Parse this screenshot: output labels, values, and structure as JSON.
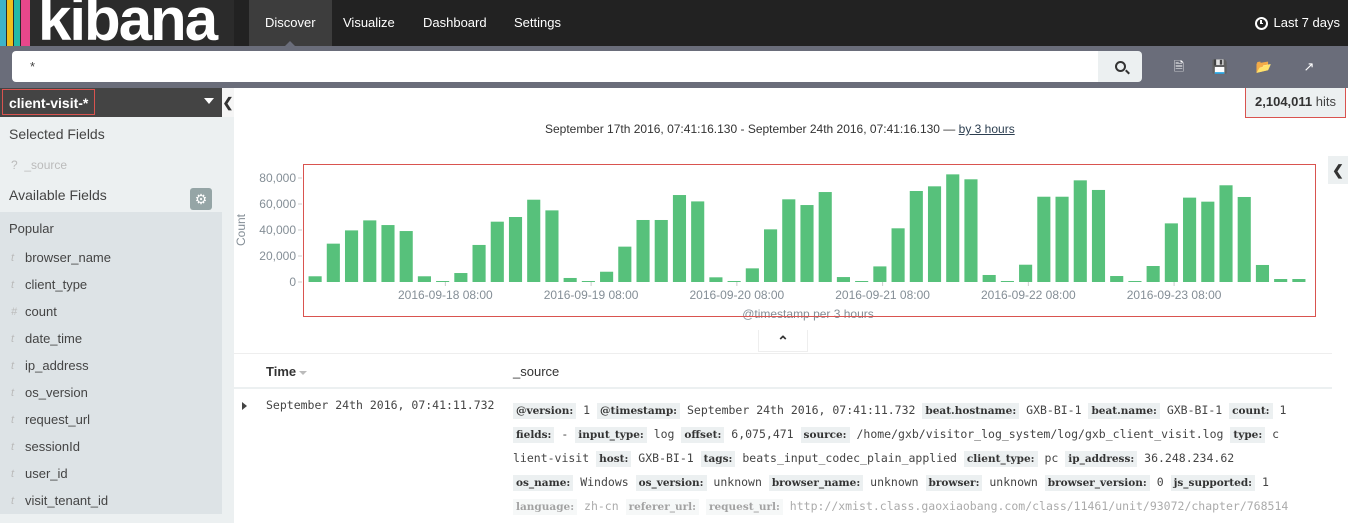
{
  "app": {
    "brand": "kibana",
    "brand_stripes": [
      "#3eb3c8",
      "#f0bf1a",
      "#24b9a6",
      "#e8478b"
    ]
  },
  "nav": {
    "tabs": [
      {
        "label": "Discover",
        "active": true
      },
      {
        "label": "Visualize",
        "active": false
      },
      {
        "label": "Dashboard",
        "active": false
      },
      {
        "label": "Settings",
        "active": false
      }
    ],
    "timepicker": "Last 7 days"
  },
  "search": {
    "query": "*",
    "toolbar_icons": [
      "new-search-icon",
      "save-search-icon",
      "open-search-icon",
      "share-icon"
    ]
  },
  "sidebar": {
    "index_pattern": "client-visit-*",
    "selected_fields_label": "Selected Fields",
    "selected_fields": [
      {
        "type": "?",
        "name": "_source"
      }
    ],
    "available_fields_label": "Available Fields",
    "popular_label": "Popular",
    "popular_fields": [
      {
        "type": "t",
        "name": "browser_name"
      },
      {
        "type": "t",
        "name": "client_type"
      },
      {
        "type": "#",
        "name": "count"
      },
      {
        "type": "t",
        "name": "date_time"
      },
      {
        "type": "t",
        "name": "ip_address"
      },
      {
        "type": "t",
        "name": "os_version"
      },
      {
        "type": "t",
        "name": "request_url"
      },
      {
        "type": "t",
        "name": "sessionId"
      },
      {
        "type": "t",
        "name": "user_id"
      },
      {
        "type": "t",
        "name": "visit_tenant_id"
      }
    ]
  },
  "hits": {
    "count": "2,104,011",
    "label": "hits"
  },
  "timerange": {
    "text": "September 17th 2016, 07:41:16.130 - September 24th 2016, 07:41:16.130 —",
    "interval_link": "by 3 hours"
  },
  "chart_data": {
    "type": "bar",
    "title": "",
    "xlabel": "@timestamp per 3 hours",
    "ylabel": "Count",
    "ylim": [
      0,
      85000
    ],
    "yticks": [
      0,
      20000,
      40000,
      60000,
      80000
    ],
    "ytick_labels": [
      "0",
      "20,000",
      "40,000",
      "60,000",
      "80,000"
    ],
    "xtick_labels": [
      "2016-09-18 08:00",
      "2016-09-19 08:00",
      "2016-09-20 08:00",
      "2016-09-21 08:00",
      "2016-09-22 08:00",
      "2016-09-23 08:00"
    ],
    "xtick_bar_index": [
      8,
      16,
      24,
      32,
      40,
      48
    ],
    "color": "#57c17b",
    "grid": false,
    "values": [
      4400,
      29500,
      39700,
      47400,
      43800,
      39200,
      4400,
      300,
      6900,
      28500,
      46400,
      50000,
      63300,
      55100,
      3100,
      300,
      7900,
      27200,
      47700,
      47700,
      66900,
      62000,
      3600,
      300,
      10500,
      40500,
      63600,
      59200,
      69200,
      3800,
      300,
      12000,
      41300,
      70000,
      73600,
      82800,
      79000,
      5400,
      300,
      13300,
      65600,
      65600,
      78200,
      70800,
      4600,
      300,
      12300,
      45100,
      64900,
      61800,
      74400,
      65400,
      13100,
      2300,
      2300
    ]
  },
  "table": {
    "columns": [
      "Time",
      "_source"
    ],
    "rows": [
      {
        "time": "September 24th 2016, 07:41:11.732",
        "source_lines": [
          [
            [
              "@version:",
              "1"
            ],
            [
              "@timestamp:",
              "September 24th 2016, 07:41:11.732"
            ],
            [
              "beat.hostname:",
              "GXB-BI-1"
            ],
            [
              "beat.name:",
              "GXB-BI-1"
            ],
            [
              "count:",
              "1"
            ]
          ],
          [
            [
              "fields:",
              " - "
            ],
            [
              "input_type:",
              "log"
            ],
            [
              "offset:",
              "6,075,471"
            ],
            [
              "source:",
              "/home/gxb/visitor_log_system/log/gxb_client_visit.log"
            ],
            [
              "type:",
              "c"
            ]
          ],
          [
            [
              "",
              "lient-visit"
            ],
            [
              "host:",
              "GXB-BI-1"
            ],
            [
              "tags:",
              "beats_input_codec_plain_applied"
            ],
            [
              "client_type:",
              "pc"
            ],
            [
              "ip_address:",
              "36.248.234.62"
            ]
          ],
          [
            [
              "os_name:",
              "Windows"
            ],
            [
              "os_version:",
              "unknown"
            ],
            [
              "browser_name:",
              "unknown"
            ],
            [
              "browser:",
              "unknown"
            ],
            [
              "browser_version:",
              "0"
            ],
            [
              "js_supported:",
              "1"
            ]
          ],
          [
            [
              "language:",
              "zh-cn"
            ],
            [
              "referer_url:",
              " "
            ],
            [
              "request_url:",
              "http://xmist.class.gaoxiaobang.com/class/11461/unit/93072/chapter/768514"
            ]
          ]
        ]
      }
    ]
  }
}
